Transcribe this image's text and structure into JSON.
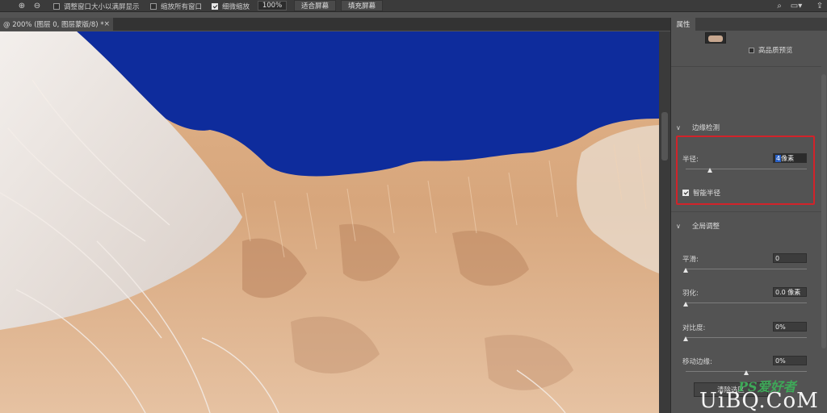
{
  "toolbar": {
    "zoom_in_icon": "zoom-in-icon",
    "zoom_out_icon": "zoom-out-icon",
    "resize_windows_label": "调整窗口大小以满屏显示",
    "resize_windows_checked": false,
    "zoom_all_label": "缩放所有窗口",
    "zoom_all_checked": false,
    "scrubby_zoom_label": "细微缩放",
    "scrubby_zoom_checked": true,
    "zoom_value": "100%",
    "fit_screen_label": "适合屏幕",
    "fill_screen_label": "填充屏幕"
  },
  "document": {
    "tab_title": "@ 200% (图层 0, 图层蒙版/8) *",
    "tab_close": "×"
  },
  "canvas": {
    "background_color": "#0e2c9c",
    "fur_color": "#d8ac85"
  },
  "panel": {
    "tab_label": "属性",
    "high_quality_preview_label": "高品质预览",
    "high_quality_preview_checked": false,
    "edge_detection": {
      "title": "边缘检测",
      "radius_label": "半径:",
      "radius_number": "4",
      "radius_unit": " 像素",
      "radius_slider": 0.2,
      "smart_radius_label": "智能半径",
      "smart_radius_checked": true
    },
    "global_refinements": {
      "title": "全局调整",
      "smooth_label": "平滑:",
      "smooth_value": "0",
      "smooth_slider": 0,
      "feather_label": "羽化:",
      "feather_value": "0.0 像素",
      "feather_slider": 0,
      "contrast_label": "对比度:",
      "contrast_value": "0%",
      "contrast_slider": 0,
      "shift_edge_label": "移动边缘:",
      "shift_edge_value": "0%",
      "shift_edge_slider": 0.5
    },
    "clear_selection_label": "清除选区",
    "highlight_color": "#d2232a"
  },
  "watermark": {
    "ps_text": "PS爱好者",
    "url_text": "UiBQ.CoM"
  }
}
